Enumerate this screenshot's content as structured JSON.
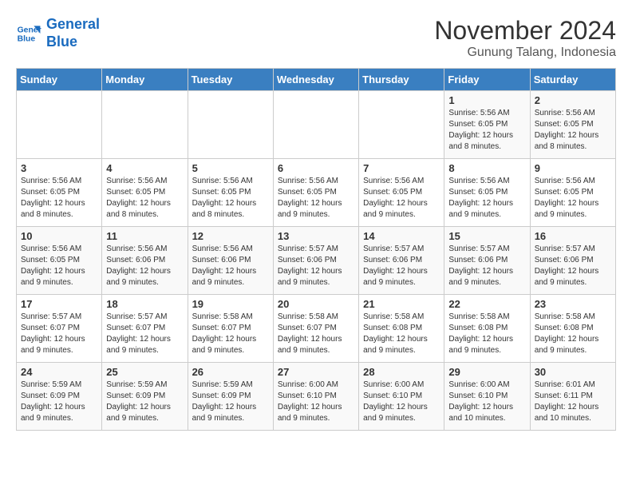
{
  "logo": {
    "line1": "General",
    "line2": "Blue"
  },
  "title": "November 2024",
  "location": "Gunung Talang, Indonesia",
  "headers": [
    "Sunday",
    "Monday",
    "Tuesday",
    "Wednesday",
    "Thursday",
    "Friday",
    "Saturday"
  ],
  "weeks": [
    [
      {
        "day": "",
        "info": ""
      },
      {
        "day": "",
        "info": ""
      },
      {
        "day": "",
        "info": ""
      },
      {
        "day": "",
        "info": ""
      },
      {
        "day": "",
        "info": ""
      },
      {
        "day": "1",
        "info": "Sunrise: 5:56 AM\nSunset: 6:05 PM\nDaylight: 12 hours\nand 8 minutes."
      },
      {
        "day": "2",
        "info": "Sunrise: 5:56 AM\nSunset: 6:05 PM\nDaylight: 12 hours\nand 8 minutes."
      }
    ],
    [
      {
        "day": "3",
        "info": "Sunrise: 5:56 AM\nSunset: 6:05 PM\nDaylight: 12 hours\nand 8 minutes."
      },
      {
        "day": "4",
        "info": "Sunrise: 5:56 AM\nSunset: 6:05 PM\nDaylight: 12 hours\nand 8 minutes."
      },
      {
        "day": "5",
        "info": "Sunrise: 5:56 AM\nSunset: 6:05 PM\nDaylight: 12 hours\nand 8 minutes."
      },
      {
        "day": "6",
        "info": "Sunrise: 5:56 AM\nSunset: 6:05 PM\nDaylight: 12 hours\nand 9 minutes."
      },
      {
        "day": "7",
        "info": "Sunrise: 5:56 AM\nSunset: 6:05 PM\nDaylight: 12 hours\nand 9 minutes."
      },
      {
        "day": "8",
        "info": "Sunrise: 5:56 AM\nSunset: 6:05 PM\nDaylight: 12 hours\nand 9 minutes."
      },
      {
        "day": "9",
        "info": "Sunrise: 5:56 AM\nSunset: 6:05 PM\nDaylight: 12 hours\nand 9 minutes."
      }
    ],
    [
      {
        "day": "10",
        "info": "Sunrise: 5:56 AM\nSunset: 6:05 PM\nDaylight: 12 hours\nand 9 minutes."
      },
      {
        "day": "11",
        "info": "Sunrise: 5:56 AM\nSunset: 6:06 PM\nDaylight: 12 hours\nand 9 minutes."
      },
      {
        "day": "12",
        "info": "Sunrise: 5:56 AM\nSunset: 6:06 PM\nDaylight: 12 hours\nand 9 minutes."
      },
      {
        "day": "13",
        "info": "Sunrise: 5:57 AM\nSunset: 6:06 PM\nDaylight: 12 hours\nand 9 minutes."
      },
      {
        "day": "14",
        "info": "Sunrise: 5:57 AM\nSunset: 6:06 PM\nDaylight: 12 hours\nand 9 minutes."
      },
      {
        "day": "15",
        "info": "Sunrise: 5:57 AM\nSunset: 6:06 PM\nDaylight: 12 hours\nand 9 minutes."
      },
      {
        "day": "16",
        "info": "Sunrise: 5:57 AM\nSunset: 6:06 PM\nDaylight: 12 hours\nand 9 minutes."
      }
    ],
    [
      {
        "day": "17",
        "info": "Sunrise: 5:57 AM\nSunset: 6:07 PM\nDaylight: 12 hours\nand 9 minutes."
      },
      {
        "day": "18",
        "info": "Sunrise: 5:57 AM\nSunset: 6:07 PM\nDaylight: 12 hours\nand 9 minutes."
      },
      {
        "day": "19",
        "info": "Sunrise: 5:58 AM\nSunset: 6:07 PM\nDaylight: 12 hours\nand 9 minutes."
      },
      {
        "day": "20",
        "info": "Sunrise: 5:58 AM\nSunset: 6:07 PM\nDaylight: 12 hours\nand 9 minutes."
      },
      {
        "day": "21",
        "info": "Sunrise: 5:58 AM\nSunset: 6:08 PM\nDaylight: 12 hours\nand 9 minutes."
      },
      {
        "day": "22",
        "info": "Sunrise: 5:58 AM\nSunset: 6:08 PM\nDaylight: 12 hours\nand 9 minutes."
      },
      {
        "day": "23",
        "info": "Sunrise: 5:58 AM\nSunset: 6:08 PM\nDaylight: 12 hours\nand 9 minutes."
      }
    ],
    [
      {
        "day": "24",
        "info": "Sunrise: 5:59 AM\nSunset: 6:09 PM\nDaylight: 12 hours\nand 9 minutes."
      },
      {
        "day": "25",
        "info": "Sunrise: 5:59 AM\nSunset: 6:09 PM\nDaylight: 12 hours\nand 9 minutes."
      },
      {
        "day": "26",
        "info": "Sunrise: 5:59 AM\nSunset: 6:09 PM\nDaylight: 12 hours\nand 9 minutes."
      },
      {
        "day": "27",
        "info": "Sunrise: 6:00 AM\nSunset: 6:10 PM\nDaylight: 12 hours\nand 9 minutes."
      },
      {
        "day": "28",
        "info": "Sunrise: 6:00 AM\nSunset: 6:10 PM\nDaylight: 12 hours\nand 9 minutes."
      },
      {
        "day": "29",
        "info": "Sunrise: 6:00 AM\nSunset: 6:10 PM\nDaylight: 12 hours\nand 10 minutes."
      },
      {
        "day": "30",
        "info": "Sunrise: 6:01 AM\nSunset: 6:11 PM\nDaylight: 12 hours\nand 10 minutes."
      }
    ]
  ]
}
